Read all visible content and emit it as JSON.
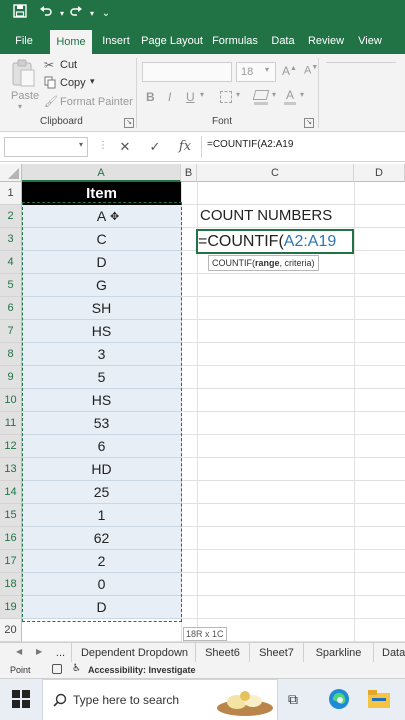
{
  "quick_access": {
    "save_icon": "save-icon",
    "undo_icon": "undo-icon",
    "redo_icon": "redo-icon",
    "customize_icon": "customize-icon"
  },
  "ribbon_tabs": [
    "File",
    "Home",
    "Insert",
    "Page Layout",
    "Formulas",
    "Data",
    "Review",
    "View"
  ],
  "active_tab": "Home",
  "clipboard": {
    "paste_label": "Paste",
    "cut_label": "Cut",
    "copy_label": "Copy",
    "format_painter_label": "Format Painter",
    "group_label": "Clipboard"
  },
  "font": {
    "size_value": "18",
    "group_label": "Font"
  },
  "formula_bar": {
    "cancel_symbol": "✕",
    "enter_symbol": "✓",
    "fx_label": "fx",
    "formula": "=COUNTIF(A2:A19"
  },
  "columns": [
    "A",
    "B",
    "C",
    "D"
  ],
  "header_cell": "Item",
  "rows": [
    "1",
    "2",
    "3",
    "4",
    "5",
    "6",
    "7",
    "8",
    "9",
    "10",
    "11",
    "12",
    "13",
    "14",
    "15",
    "16",
    "17",
    "18",
    "19",
    "20"
  ],
  "items": [
    "A",
    "C",
    "D",
    "G",
    "SH",
    "HS",
    "3",
    "5",
    "HS",
    "53",
    "6",
    "HD",
    "25",
    "1",
    "62",
    "2",
    "0",
    "D"
  ],
  "count_title": "COUNT NUMBERS",
  "edit_cell": {
    "prefix": "=COUNTIF(",
    "range": "A2:A19"
  },
  "tooltip": {
    "fn": "COUNTIF(",
    "arg1": "range",
    "rest": ", criteria)"
  },
  "selection_size": "18R x 1C",
  "sheet_tabs": [
    "...",
    "Dependent Dropdown",
    "Sheet6",
    "Sheet7",
    "Sparkline",
    "Data"
  ],
  "status": {
    "mode": "Point",
    "accessibility": "Accessibility: Investigate"
  },
  "taskbar": {
    "search_placeholder": "Type here to search"
  },
  "colors": {
    "excel_green": "#217346",
    "selection_fill": "#e8eef6",
    "range_blue": "#2e75b6"
  }
}
